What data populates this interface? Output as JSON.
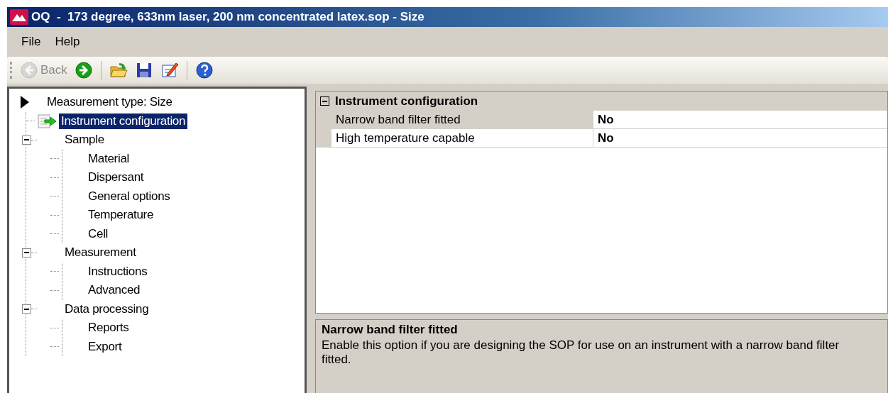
{
  "window": {
    "title": "OQ  -  173 degree, 633nm laser, 200 nm concentrated latex.sop - Size"
  },
  "menu": [
    "File",
    "Help"
  ],
  "toolbar": [
    {
      "kind": "back",
      "label": "Back",
      "disabled": true
    },
    {
      "kind": "forward",
      "disabled": false
    },
    {
      "kind": "separator"
    },
    {
      "kind": "open",
      "disabled": false
    },
    {
      "kind": "save",
      "disabled": false
    },
    {
      "kind": "edit",
      "disabled": false
    },
    {
      "kind": "separator"
    },
    {
      "kind": "help",
      "disabled": false
    }
  ],
  "tree": {
    "label": "Measurement type: Size",
    "children": [
      {
        "label": "Instrument configuration",
        "selected": true
      },
      {
        "label": "Sample",
        "selected": false,
        "expanded": true,
        "children": [
          {
            "label": "Material",
            "selected": false
          },
          {
            "label": "Dispersant",
            "selected": false
          },
          {
            "label": "General options",
            "selected": false
          },
          {
            "label": "Temperature",
            "selected": false
          },
          {
            "label": "Cell",
            "selected": false
          }
        ]
      },
      {
        "label": "Measurement",
        "selected": false,
        "expanded": true,
        "children": [
          {
            "label": "Instructions",
            "selected": false
          },
          {
            "label": "Advanced",
            "selected": false
          }
        ]
      },
      {
        "label": "Data processing",
        "selected": false,
        "expanded": true,
        "children": [
          {
            "label": "Reports",
            "selected": false
          },
          {
            "label": "Export",
            "selected": false
          }
        ]
      }
    ]
  },
  "property_grid": {
    "category": "Instrument configuration",
    "expanded": true,
    "rows": [
      {
        "name": "Narrow band filter fitted",
        "value": "No",
        "selected": true
      },
      {
        "name": "High temperature capable",
        "value": "No",
        "selected": false
      }
    ]
  },
  "description": {
    "title": "Narrow band filter fitted",
    "text": "Enable this option if you are designing the SOP for use on an instrument with a narrow band filter fitted."
  }
}
